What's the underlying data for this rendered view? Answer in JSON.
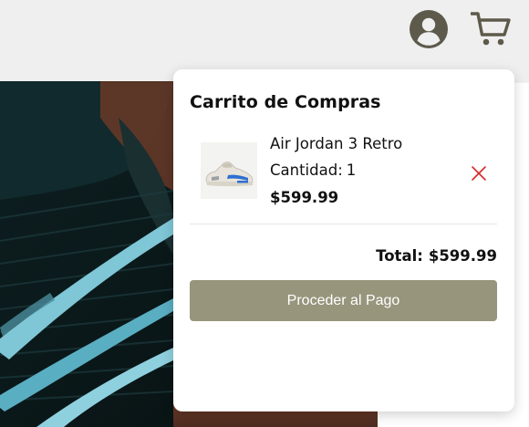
{
  "header": {
    "user_icon": "user-circle-icon",
    "cart_icon": "shopping-cart-icon",
    "icon_color": "#5d5a4b"
  },
  "cart": {
    "title": "Carrito de Compras",
    "items": [
      {
        "name": "Air Jordan 3 Retro",
        "quantity_label": "Cantidad:",
        "quantity": "1",
        "price": "$599.99",
        "thumbnail": "sneaker-thumbnail",
        "remove_icon": "close-icon"
      }
    ],
    "total_label": "Total:",
    "total_value": "$599.99",
    "checkout_label": "Proceder al Pago"
  },
  "colors": {
    "checkout_button": "#97957c",
    "remove_icon": "#d62b2b",
    "header_bg": "#efefef"
  }
}
